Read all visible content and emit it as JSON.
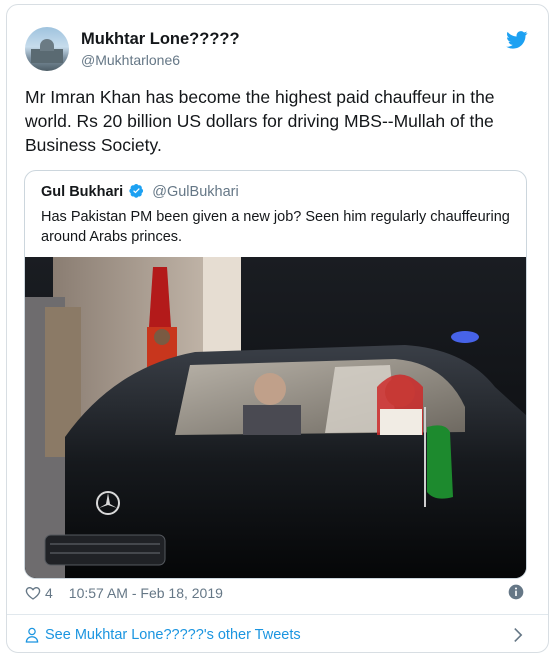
{
  "author": {
    "display_name": "Mukhtar Lone?????",
    "handle": "@Mukhtarlone6",
    "avatar_icon": "avatar-photo"
  },
  "tweet": {
    "text": "Mr Imran Khan has become the highest paid chauffeur in the world. Rs 20 billion US dollars for driving MBS--Mullah of the Business Society."
  },
  "quoted": {
    "display_name": "Gul Bukhari",
    "handle": "@GulBukhari",
    "verified": true,
    "text": "Has Pakistan PM been given a new job? Seen him regularly chauffeuring around Arabs princes.",
    "media_description_icon": "photo-car-icon"
  },
  "meta": {
    "like_count": "4",
    "timestamp": "10:57 AM - Feb 18, 2019"
  },
  "footer": {
    "see_more_label": "See Mukhtar Lone?????'s other Tweets"
  },
  "colors": {
    "twitter_blue": "#1da1f2",
    "link_blue": "#1b95e0",
    "secondary_text": "#657786",
    "border": "#ccd6dd"
  }
}
